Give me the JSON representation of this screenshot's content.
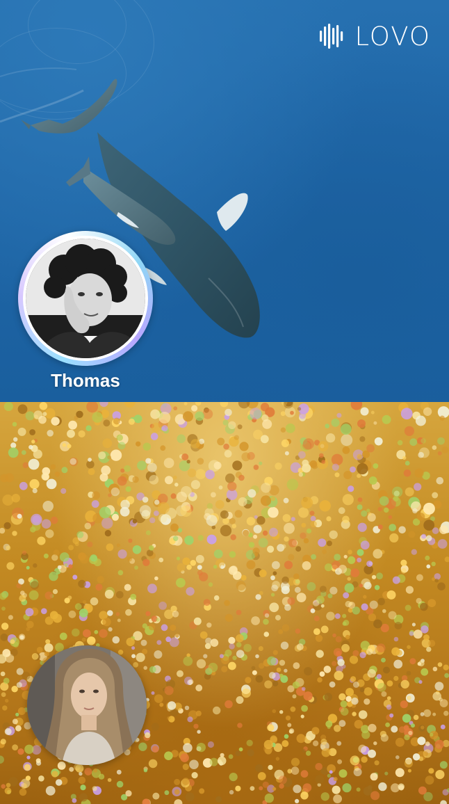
{
  "brand": {
    "logo_text": "LOVO",
    "logo_icon": "sound-wave-icon",
    "logo_color": "#ffffff"
  },
  "top_scene": {
    "background": "ocean-with-whales",
    "color": "#1f66a7"
  },
  "bottom_scene": {
    "background": "gold-glitter",
    "color": "#c38a22"
  },
  "speakers": [
    {
      "name": "Thomas",
      "avatar": "man-thinking-portrait",
      "active": true
    },
    {
      "name": "",
      "avatar": "woman-portrait",
      "active": false
    }
  ]
}
